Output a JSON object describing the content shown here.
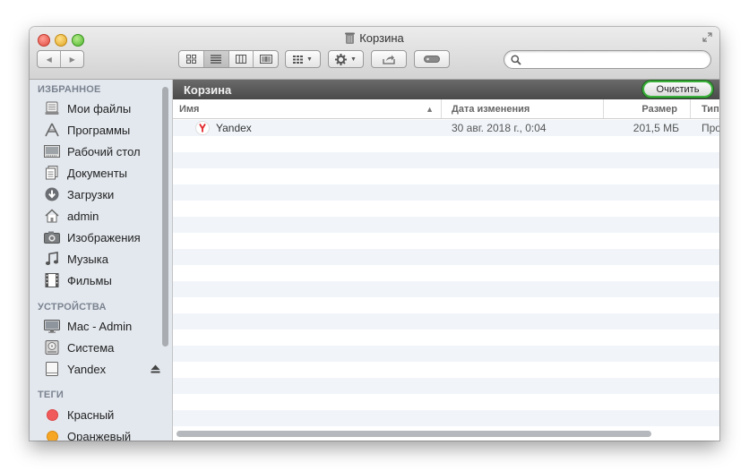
{
  "window": {
    "title": "Корзина"
  },
  "toolbar": {
    "back_label": "◀",
    "forward_label": "▶",
    "search": {
      "value": "",
      "placeholder": ""
    }
  },
  "sidebar": {
    "favorites_heading": "ИЗБРАННОЕ",
    "favorites": [
      {
        "label": "Мои файлы",
        "icon": "all-files-icon"
      },
      {
        "label": "Программы",
        "icon": "applications-icon"
      },
      {
        "label": "Рабочий стол",
        "icon": "desktop-icon"
      },
      {
        "label": "Документы",
        "icon": "documents-icon"
      },
      {
        "label": "Загрузки",
        "icon": "downloads-icon"
      },
      {
        "label": "admin",
        "icon": "home-icon"
      },
      {
        "label": "Изображения",
        "icon": "pictures-icon"
      },
      {
        "label": "Музыка",
        "icon": "music-icon"
      },
      {
        "label": "Фильмы",
        "icon": "movies-icon"
      }
    ],
    "devices_heading": "УСТРОЙСТВА",
    "devices": [
      {
        "label": "Mac - Admin",
        "icon": "computer-icon"
      },
      {
        "label": "Система",
        "icon": "hard-disk-icon"
      },
      {
        "label": "Yandex",
        "icon": "external-drive-icon"
      }
    ],
    "tags_heading": "ТЕГИ",
    "tags": [
      {
        "label": "Красный",
        "color": "#f05a5a"
      },
      {
        "label": "Оранжевый",
        "color": "#f6a623"
      }
    ]
  },
  "pathbar": {
    "title": "Корзина",
    "empty_button": "Очистить"
  },
  "columns": {
    "name": "Имя",
    "sort_arrow": "▲",
    "date": "Дата изменения",
    "size": "Размер",
    "kind": "Тип"
  },
  "files": [
    {
      "name": "Yandex",
      "date": "30 авг. 2018 г., 0:04",
      "size": "201,5 МБ",
      "kind": "Про"
    }
  ],
  "colors": {
    "empty_button_border": "#3bb13b",
    "row_alt": "#f1f5fa",
    "sidebar_bg": "#e3e8ee"
  }
}
